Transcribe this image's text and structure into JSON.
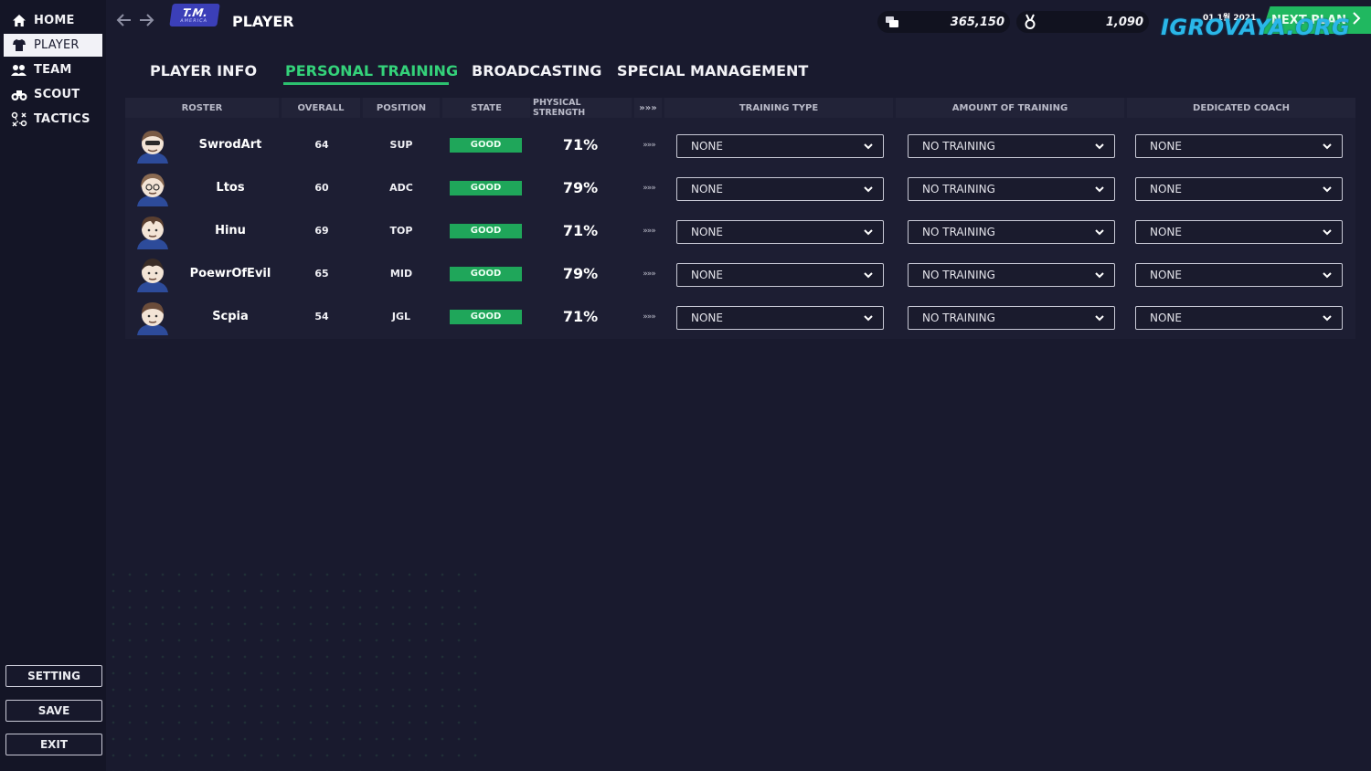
{
  "sidebar": {
    "items": [
      {
        "label": "HOME",
        "icon": "home-icon"
      },
      {
        "label": "PLAYER",
        "icon": "player-shirt-icon",
        "active": true
      },
      {
        "label": "TEAM",
        "icon": "team-icon"
      },
      {
        "label": "SCOUT",
        "icon": "binoculars-icon"
      },
      {
        "label": "TACTICS",
        "icon": "tactics-icon"
      }
    ],
    "buttons": {
      "setting": "SETTING",
      "save": "SAVE",
      "exit": "EXIT"
    }
  },
  "header": {
    "logo_text": "T.M.",
    "logo_subtext": "AMERICA",
    "title": "PLAYER",
    "money": "365,150",
    "fans": "1,090",
    "date": "01 1월 2021",
    "next_label": "NEXT PLAN",
    "watermark": "IGROVAYA.ORG"
  },
  "tabs": [
    {
      "label": "PLAYER INFO",
      "active": false
    },
    {
      "label": "PERSONAL TRAINING",
      "active": true
    },
    {
      "label": "BROADCASTING",
      "active": false
    },
    {
      "label": "SPECIAL MANAGEMENT",
      "active": false
    }
  ],
  "table": {
    "headers": {
      "roster": "ROSTER",
      "overall": "OVERALL",
      "position": "POSITION",
      "state": "STATE",
      "physical": "PHYSICAL STRENGTH",
      "arrow": "»»»",
      "training_type": "TRAINING TYPE",
      "amount": "AMOUNT OF TRAINING",
      "coach": "DEDICATED COACH"
    },
    "rows": [
      {
        "name": "SwrodArt",
        "overall": "64",
        "position": "SUP",
        "state": "GOOD",
        "physical": "71%",
        "arrow": "»»»",
        "training_type": "NONE",
        "amount": "NO TRAINING",
        "coach": "NONE"
      },
      {
        "name": "Ltos",
        "overall": "60",
        "position": "ADC",
        "state": "GOOD",
        "physical": "79%",
        "arrow": "»»»",
        "training_type": "NONE",
        "amount": "NO TRAINING",
        "coach": "NONE"
      },
      {
        "name": "Hinu",
        "overall": "69",
        "position": "TOP",
        "state": "GOOD",
        "physical": "71%",
        "arrow": "»»»",
        "training_type": "NONE",
        "amount": "NO TRAINING",
        "coach": "NONE"
      },
      {
        "name": "PoewrOfEvil",
        "overall": "65",
        "position": "MID",
        "state": "GOOD",
        "physical": "79%",
        "arrow": "»»»",
        "training_type": "NONE",
        "amount": "NO TRAINING",
        "coach": "NONE"
      },
      {
        "name": "Scpia",
        "overall": "54",
        "position": "JGL",
        "state": "GOOD",
        "physical": "71%",
        "arrow": "»»»",
        "training_type": "NONE",
        "amount": "NO TRAINING",
        "coach": "NONE"
      }
    ]
  },
  "colors": {
    "background": "#191a2e",
    "accent_green": "#2cc06f",
    "badge_green": "#1fa65a"
  }
}
